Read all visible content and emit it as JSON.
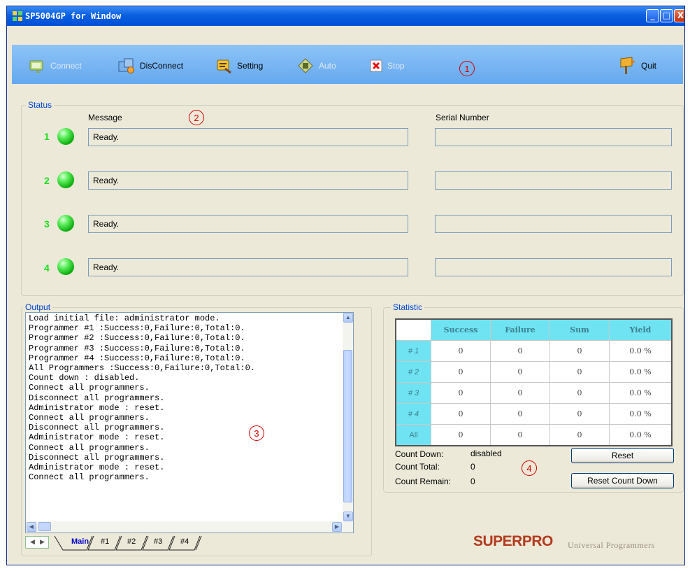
{
  "window": {
    "title": "SP5004GP for Window",
    "controls": {
      "minimize": "_",
      "maximize": "□",
      "close": "X"
    }
  },
  "toolbar": {
    "items": [
      {
        "label": "Connect",
        "icon": "connect-icon",
        "enabled": false
      },
      {
        "label": "DisConnect",
        "icon": "disconnect-icon",
        "enabled": true
      },
      {
        "label": "Setting",
        "icon": "setting-icon",
        "enabled": true
      },
      {
        "label": "Auto",
        "icon": "auto-icon",
        "enabled": false
      },
      {
        "label": "Stop",
        "icon": "stop-icon",
        "enabled": false
      },
      {
        "label": "Quit",
        "icon": "quit-icon",
        "enabled": true
      }
    ]
  },
  "annotations": [
    "1",
    "2",
    "3",
    "4"
  ],
  "status": {
    "group_label": "Status",
    "message_header": "Message",
    "serial_header": "Serial Number",
    "rows": [
      {
        "num": "1",
        "message": "Ready.",
        "serial": ""
      },
      {
        "num": "2",
        "message": "Ready.",
        "serial": ""
      },
      {
        "num": "3",
        "message": "Ready.",
        "serial": ""
      },
      {
        "num": "4",
        "message": "Ready.",
        "serial": ""
      }
    ]
  },
  "output": {
    "group_label": "Output",
    "lines": [
      "Load initial file: administrator mode.",
      "Programmer #1 :Success:0,Failure:0,Total:0.",
      "Programmer #2 :Success:0,Failure:0,Total:0.",
      "Programmer #3 :Success:0,Failure:0,Total:0.",
      "Programmer #4 :Success:0,Failure:0,Total:0.",
      "All Programmers :Success:0,Failure:0,Total:0.",
      "Count down : disabled.",
      "Connect all programmers.",
      "Disconnect all programmers.",
      "Administrator mode : reset.",
      "Connect all programmers.",
      "Disconnect all programmers.",
      "Administrator mode : reset.",
      "Connect all programmers.",
      "Disconnect all programmers.",
      "Administrator mode : reset.",
      "Connect all programmers."
    ],
    "tabs": [
      "Main",
      "#1",
      "#2",
      "#3",
      "#4"
    ],
    "active_tab": "Main"
  },
  "statistic": {
    "group_label": "Statistic",
    "columns": [
      "Success",
      "Failure",
      "Sum",
      "Yield"
    ],
    "rows": [
      {
        "label": "# 1",
        "values": [
          "0",
          "0",
          "0",
          "0.0 %"
        ]
      },
      {
        "label": "# 2",
        "values": [
          "0",
          "0",
          "0",
          "0.0 %"
        ]
      },
      {
        "label": "# 3",
        "values": [
          "0",
          "0",
          "0",
          "0.0 %"
        ]
      },
      {
        "label": "# 4",
        "values": [
          "0",
          "0",
          "0",
          "0.0 %"
        ]
      },
      {
        "label": "All",
        "values": [
          "0",
          "0",
          "0",
          "0.0 %"
        ]
      }
    ],
    "count_down_label": "Count Down:",
    "count_down_value": "disabled",
    "count_total_label": "Count Total:",
    "count_total_value": "0",
    "count_remain_label": "Count Remain:",
    "count_remain_value": "0",
    "reset_button": "Reset",
    "reset_count_down_button": "Reset Count Down"
  },
  "branding": {
    "logo": "SUPERPRO",
    "tagline": "Universal Programmers"
  },
  "colors": {
    "title_bar": "#0a5fe0",
    "toolbar": "#7ab8f4",
    "led": "#10b010",
    "group_title": "#0046d5",
    "table_header": "#6fe3f2",
    "annotation": "#d40000"
  }
}
